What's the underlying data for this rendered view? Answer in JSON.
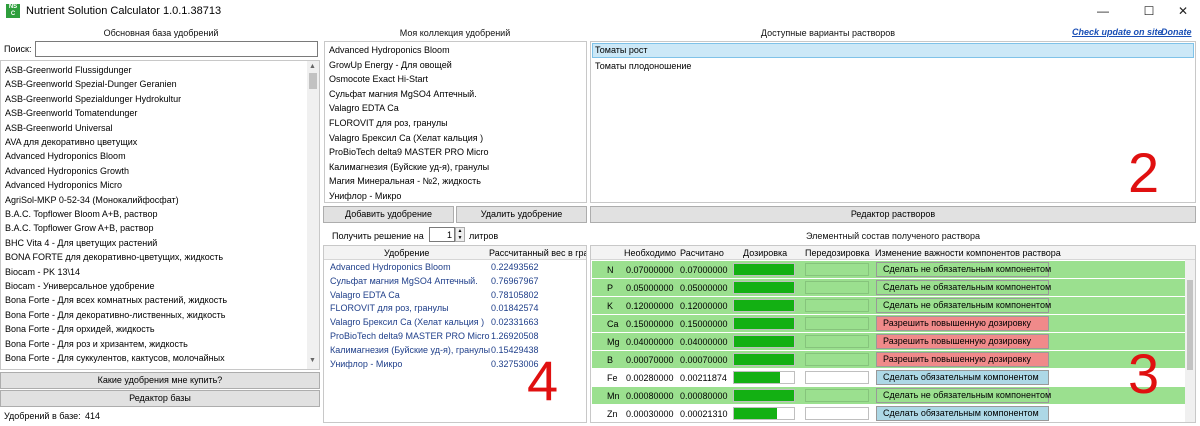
{
  "window": {
    "title": "Nutrient Solution Calculator 1.0.1.38713",
    "icon_text": "NS C",
    "minimize": "—",
    "maximize": "☐",
    "close": "✕"
  },
  "base": {
    "header": "Обсновная база удобрений",
    "search_label": "Поиск:",
    "search_value": "",
    "items": [
      "ASB-Greenworld Flussigdunger",
      "ASB-Greenworld Spezial-Dunger Geranien",
      "ASB-Greenworld Spezialdunger Hydrokultur",
      "ASB-Greenworld Tomatendunger",
      "ASB-Greenworld Universal",
      "AVA для декоративно цветущих",
      "Advanced Hydroponics Bloom",
      "Advanced Hydroponics Growth",
      "Advanced Hydroponics Micro",
      "AgriSol-MKP 0-52-34 (Монокалийфосфат)",
      "B.A.C. Topflower Bloom A+B, раствор",
      "B.A.C. Topflower Grow A+B, раствор",
      "BHC Vita 4 - Для цветущих растений",
      "BONA FORTE для декоративно-цветущих, жидкость",
      "Biocam - PK 13\\14",
      "Biocam - Универсальное удобрение",
      "Bona Forte - Для всех комнатных растений, жидкость",
      "Bona Forte - Для декоративно-лиственных, жидкость",
      "Bona Forte - Для орхидей, жидкость",
      "Bona Forte - Для роз и хризантем, жидкость",
      "Bona Forte - Для суккулентов, кактусов, молочайных"
    ],
    "which_button": "Какие удобрения мне купить?",
    "editor_button": "Редактор базы",
    "count_label": "Удобрений в базе:",
    "count_value": "414"
  },
  "collection": {
    "header": "Моя коллекция удобрений",
    "items": [
      "Advanced Hydroponics Bloom",
      "GrowUp Energy - Для овощей",
      "Osmocote Exact Hi-Start",
      "Сульфат магния MgSO4 Аптечный.",
      "Valagro EDTA Ca",
      "FLOROVIT для роз, гранулы",
      "Valagro Брексил Ca (Хелат кальция )",
      "ProBioTech delta9 MASTER PRO Micro",
      "Калимагнезия (Буйские уд-я), гранулы",
      "Магия Минеральная - №2, жидкость",
      "Унифлор - Микро"
    ],
    "add_button": "Добавить удобрение",
    "delete_button": "Удалить удобрение"
  },
  "solve": {
    "label": "Получить решение на",
    "liters": "1",
    "unit": "литров",
    "col_fert": "Удобрение",
    "col_weight": "Рассчитанный вес в грам",
    "rows": [
      {
        "name": "Advanced Hydroponics Bloom",
        "weight": "0.22493562"
      },
      {
        "name": "Сульфат магния MgSO4 Аптечный.",
        "weight": "0.76967967"
      },
      {
        "name": "Valagro EDTA Ca",
        "weight": "0.78105802"
      },
      {
        "name": "FLOROVIT для роз, гранулы",
        "weight": "0.01842574"
      },
      {
        "name": "Valagro Брексил Ca (Хелат кальция )",
        "weight": "0.02331663"
      },
      {
        "name": "ProBioTech delta9 MASTER PRO Micro",
        "weight": "1.26920508"
      },
      {
        "name": "Калимагнезия (Буйские уд-я), гранулы",
        "weight": "0.15429438"
      },
      {
        "name": "Унифлор - Микро",
        "weight": "0.32753006"
      }
    ],
    "overlay_number": "4"
  },
  "solutions": {
    "header": "Доступные варианты растворов",
    "check_update": "Check update on site",
    "donate": "Donate",
    "items": [
      "Томаты рост",
      "Томаты плодоношение"
    ],
    "selected_index": 0,
    "editor_button": "Редактор растворов",
    "overlay_number": "2"
  },
  "composition": {
    "header": "Элементный состав полученого раствора",
    "col_need": "Необходимо",
    "col_calc": "Расчитано",
    "col_dose": "Дозировка",
    "col_over": "Передозировка",
    "col_change": "Изменение важности компонентов раствора",
    "rows": [
      {
        "el": "N",
        "need": "0.07000000",
        "calc": "0.07000000",
        "dose": 1.0,
        "over": true,
        "action": "Сделать не обязательным компонентом",
        "action_color": "#9be08f",
        "row_green": true
      },
      {
        "el": "P",
        "need": "0.05000000",
        "calc": "0.05000000",
        "dose": 1.0,
        "over": true,
        "action": "Сделать не обязательным компонентом",
        "action_color": "#9be08f",
        "row_green": true
      },
      {
        "el": "K",
        "need": "0.12000000",
        "calc": "0.12000000",
        "dose": 1.0,
        "over": true,
        "action": "Сделать не обязательным компонентом",
        "action_color": "#9be08f",
        "row_green": true
      },
      {
        "el": "Ca",
        "need": "0.15000000",
        "calc": "0.15000000",
        "dose": 1.0,
        "over": true,
        "action": "Разрешить повышенную дозировку",
        "action_color": "#f08a8a",
        "row_green": true
      },
      {
        "el": "Mg",
        "need": "0.04000000",
        "calc": "0.04000000",
        "dose": 1.0,
        "over": true,
        "action": "Разрешить повышенную дозировку",
        "action_color": "#f08a8a",
        "row_green": true
      },
      {
        "el": "B",
        "need": "0.00070000",
        "calc": "0.00070000",
        "dose": 1.0,
        "over": true,
        "action": "Разрешить повышенную дозировку",
        "action_color": "#f08a8a",
        "row_green": true
      },
      {
        "el": "Fe",
        "need": "0.00280000",
        "calc": "0.00211874",
        "dose": 0.76,
        "over": false,
        "action": "Сделать обязательным компонентом",
        "action_color": "#add8e6",
        "row_green": false
      },
      {
        "el": "Mn",
        "need": "0.00080000",
        "calc": "0.00080000",
        "dose": 1.0,
        "over": true,
        "action": "Сделать не обязательным компонентом",
        "action_color": "#9be08f",
        "row_green": true
      },
      {
        "el": "Zn",
        "need": "0.00030000",
        "calc": "0.00021310",
        "dose": 0.71,
        "over": false,
        "action": "Сделать обязательным компонентом",
        "action_color": "#add8e6",
        "row_green": false
      }
    ],
    "overlay_number": "3"
  }
}
